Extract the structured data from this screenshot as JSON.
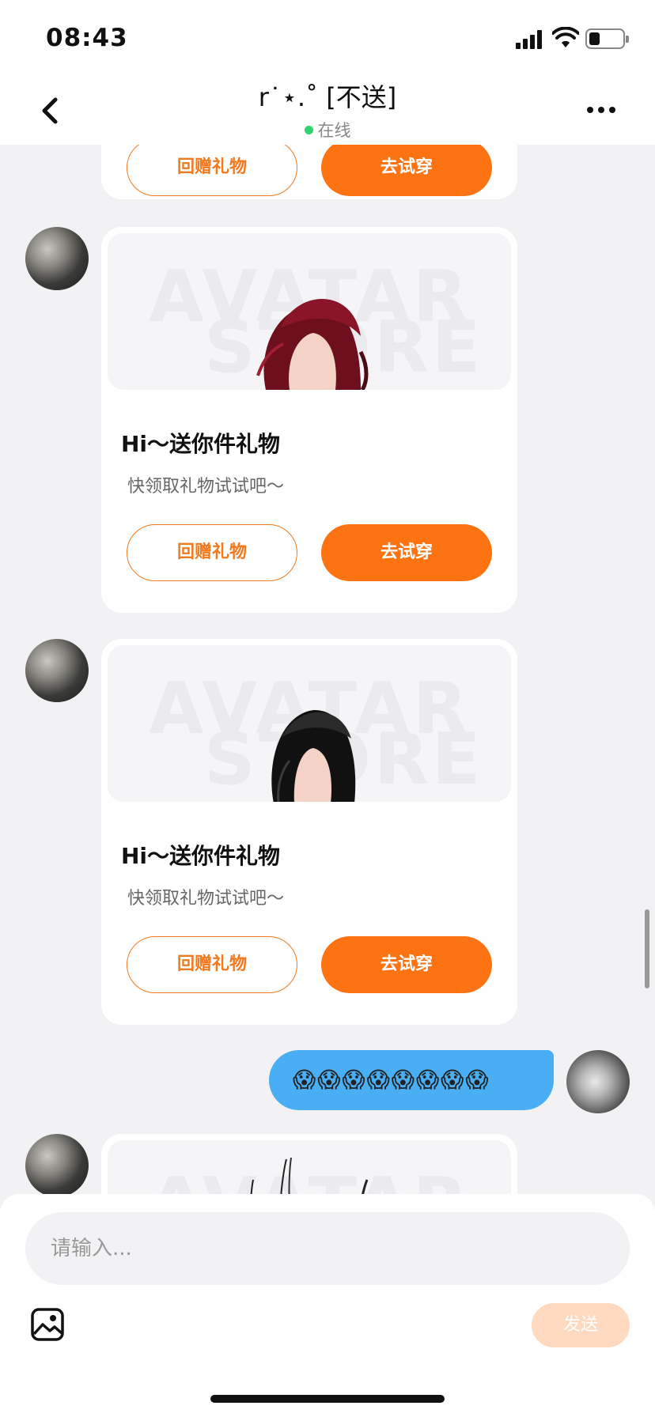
{
  "status_bar": {
    "time": "08:43",
    "icons": [
      "signal-icon",
      "wifi-icon",
      "battery-icon"
    ]
  },
  "header": {
    "title": "r˙⋆.˚ [不送]",
    "status": "在线",
    "status_color": "#2fd46b",
    "back_icon": "chevron-left-icon",
    "menu_icon": "more-horizontal-icon"
  },
  "messages": [
    {
      "type": "gift_card",
      "sender": "other",
      "watermark": "AVATAR STORE",
      "greeting": "Hi～送你件礼物",
      "subtitle": "快领取礼物试试吧～",
      "return_label": "回赠礼物",
      "tryon_label": "去试穿",
      "hair": "dark-red"
    },
    {
      "type": "gift_card",
      "sender": "other",
      "watermark": "AVATAR STORE",
      "greeting": "Hi～送你件礼物",
      "subtitle": "快领取礼物试试吧～",
      "return_label": "回赠礼物",
      "tryon_label": "去试穿",
      "hair": "black"
    },
    {
      "type": "text",
      "sender": "me",
      "text": "😱😱😱😱😱😱😱😱",
      "bubble_color": "#4aaef5"
    }
  ],
  "partial_top_card": {
    "return_label": "回赠礼物",
    "tryon_label": "去试穿"
  },
  "input": {
    "placeholder": "请输入...",
    "value": "",
    "image_icon": "image-icon",
    "send_label": "发送"
  },
  "colors": {
    "accent": "#fd7311",
    "send_disabled": "#ffd9c0"
  }
}
